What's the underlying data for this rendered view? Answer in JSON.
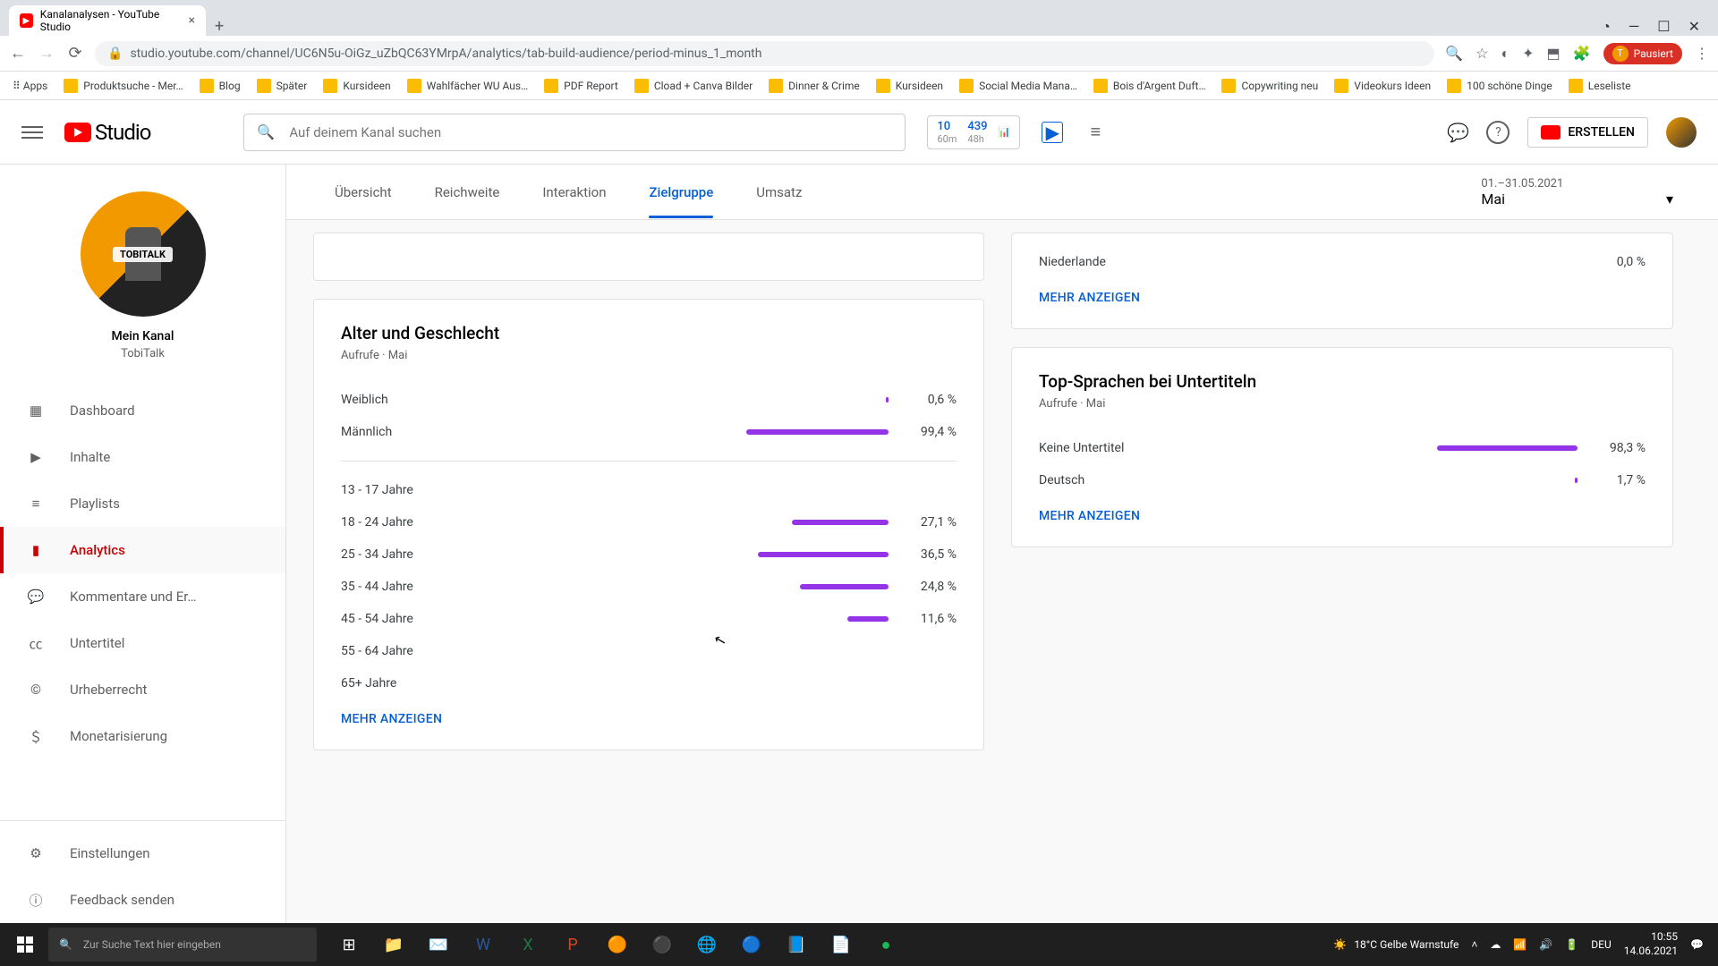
{
  "browser": {
    "tab_title": "Kanalanalysen - YouTube Studio",
    "url": "studio.youtube.com/channel/UC6N5u-OiGz_uZbQC63YMrpA/analytics/tab-build-audience/period-minus_1_month",
    "profile_status": "Pausiert",
    "bookmarks": [
      "Apps",
      "Produktsuche - Mer…",
      "Blog",
      "Später",
      "Kursideen",
      "Wahlfächer WU Aus…",
      "PDF Report",
      "Cload + Canva Bilder",
      "Dinner & Crime",
      "Kursideen",
      "Social Media Mana…",
      "Bois d'Argent Duft…",
      "Copywriting neu",
      "Videokurs Ideen",
      "100 schöne Dinge",
      "Leseliste"
    ]
  },
  "header": {
    "logo_text": "Studio",
    "search_placeholder": "Auf deinem Kanal suchen",
    "stats": {
      "n1": "10",
      "s1": "60m",
      "n2": "439",
      "s2": "48h"
    },
    "create_label": "ERSTELLEN"
  },
  "sidebar": {
    "channel_label": "Mein Kanal",
    "channel_name": "TobiTalk",
    "avatar_text": "TOBITALK",
    "items": [
      {
        "label": "Dashboard"
      },
      {
        "label": "Inhalte"
      },
      {
        "label": "Playlists"
      },
      {
        "label": "Analytics"
      },
      {
        "label": "Kommentare und Er…"
      },
      {
        "label": "Untertitel"
      },
      {
        "label": "Urheberrecht"
      },
      {
        "label": "Monetarisierung"
      }
    ],
    "bottom": [
      {
        "label": "Einstellungen"
      },
      {
        "label": "Feedback senden"
      }
    ]
  },
  "tabs": {
    "items": [
      "Übersicht",
      "Reichweite",
      "Interaktion",
      "Zielgruppe",
      "Umsatz"
    ],
    "active_index": 3,
    "period_range": "01.–31.05.2021",
    "period_name": "Mai"
  },
  "card_age": {
    "title": "Alter und Geschlecht",
    "subtitle": "Aufrufe · Mai",
    "gender": [
      {
        "label": "Weiblich",
        "value": "0,6 %",
        "pct": 0.6
      },
      {
        "label": "Männlich",
        "value": "99,4 %",
        "pct": 99.4
      }
    ],
    "ages": [
      {
        "label": "13 - 17 Jahre",
        "value": "",
        "pct": 0
      },
      {
        "label": "18 - 24 Jahre",
        "value": "27,1 %",
        "pct": 27.1
      },
      {
        "label": "25 - 34 Jahre",
        "value": "36,5 %",
        "pct": 36.5
      },
      {
        "label": "35 - 44 Jahre",
        "value": "24,8 %",
        "pct": 24.8
      },
      {
        "label": "45 - 54 Jahre",
        "value": "11,6 %",
        "pct": 11.6
      },
      {
        "label": "55 - 64 Jahre",
        "value": "",
        "pct": 0
      },
      {
        "label": "65+ Jahre",
        "value": "",
        "pct": 0
      }
    ],
    "more": "MEHR ANZEIGEN"
  },
  "card_countries": {
    "rows": [
      {
        "label": "Niederlande",
        "value": "0,0 %",
        "pct": 0
      }
    ],
    "more": "MEHR ANZEIGEN"
  },
  "card_langs": {
    "title": "Top-Sprachen bei Untertiteln",
    "subtitle": "Aufrufe · Mai",
    "rows": [
      {
        "label": "Keine Untertitel",
        "value": "98,3 %",
        "pct": 98.3
      },
      {
        "label": "Deutsch",
        "value": "1,7 %",
        "pct": 1.7
      }
    ],
    "more": "MEHR ANZEIGEN"
  },
  "taskbar": {
    "search_placeholder": "Zur Suche Text hier eingeben",
    "weather": "18°C  Gelbe Warnstufe",
    "lang": "DEU",
    "time": "10:55",
    "date": "14.06.2021"
  },
  "chart_data": [
    {
      "type": "bar",
      "title": "Alter und Geschlecht — Geschlecht",
      "categories": [
        "Weiblich",
        "Männlich"
      ],
      "values": [
        0.6,
        99.4
      ],
      "xlabel": "",
      "ylabel": "Aufrufe %",
      "ylim": [
        0,
        100
      ]
    },
    {
      "type": "bar",
      "title": "Alter und Geschlecht — Alter",
      "categories": [
        "13-17",
        "18-24",
        "25-34",
        "35-44",
        "45-54",
        "55-64",
        "65+"
      ],
      "values": [
        0,
        27.1,
        36.5,
        24.8,
        11.6,
        0,
        0
      ],
      "xlabel": "Alter",
      "ylabel": "Aufrufe %",
      "ylim": [
        0,
        40
      ]
    },
    {
      "type": "bar",
      "title": "Top-Sprachen bei Untertiteln",
      "categories": [
        "Keine Untertitel",
        "Deutsch"
      ],
      "values": [
        98.3,
        1.7
      ],
      "xlabel": "",
      "ylabel": "Aufrufe %",
      "ylim": [
        0,
        100
      ]
    }
  ]
}
